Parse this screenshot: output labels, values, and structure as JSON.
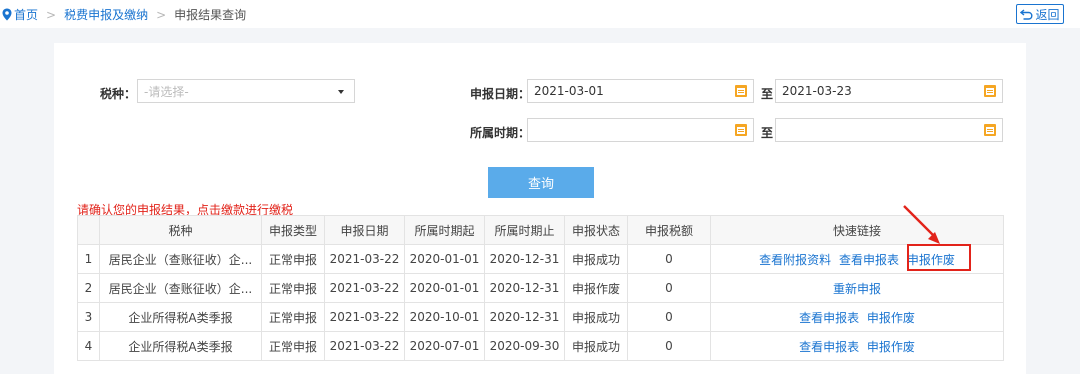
{
  "breadcrumb": {
    "home": "首页",
    "section": "税费申报及缴纳",
    "current": "申报结果查询",
    "separator": ">"
  },
  "back_label": "返回",
  "form": {
    "tax_type_label": "税种：",
    "tax_type_placeholder": "-请选择-",
    "declare_date_label": "申报日期：",
    "declare_date_from": "2021-03-01",
    "declare_date_to": "2021-03-23",
    "period_label": "所属时期：",
    "period_from": "",
    "period_to": "",
    "to_label": "至",
    "query_label": "查询"
  },
  "notice": "请确认您的申报结果，点击缴款进行缴税",
  "table": {
    "headers": [
      "",
      "税种",
      "申报类型",
      "申报日期",
      "所属时期起",
      "所属时期止",
      "申报状态",
      "申报税额",
      "快速链接"
    ],
    "rows": [
      {
        "no": "1",
        "tax": "居民企业（查账征收）企...",
        "type": "正常申报",
        "date": "2021-03-22",
        "from": "2020-01-01",
        "to": "2020-12-31",
        "status": "申报成功",
        "amount": "0",
        "links": [
          "查看附报资料",
          "查看申报表",
          "申报作废"
        ]
      },
      {
        "no": "2",
        "tax": "居民企业（查账征收）企...",
        "type": "正常申报",
        "date": "2021-03-22",
        "from": "2020-01-01",
        "to": "2020-12-31",
        "status": "申报作废",
        "amount": "0",
        "links": [
          "重新申报"
        ]
      },
      {
        "no": "3",
        "tax": "企业所得税A类季报",
        "type": "正常申报",
        "date": "2021-03-22",
        "from": "2020-10-01",
        "to": "2020-12-31",
        "status": "申报成功",
        "amount": "0",
        "links": [
          "查看申报表",
          "申报作废"
        ]
      },
      {
        "no": "4",
        "tax": "企业所得税A类季报",
        "type": "正常申报",
        "date": "2021-03-22",
        "from": "2020-07-01",
        "to": "2020-09-30",
        "status": "申报成功",
        "amount": "0",
        "links": [
          "查看申报表",
          "申报作废"
        ]
      }
    ]
  },
  "colors": {
    "link": "#1a74d0",
    "query_button": "#5aabea",
    "notice": "#e2231a",
    "highlight": "#e2231a",
    "calendar_icon": "#f5a623"
  },
  "icons": {
    "breadcrumb": "location-pin-icon",
    "back": "return-arrow-icon",
    "calendar": "calendar-icon",
    "select": "caret-down-icon",
    "annotation": "red-arrow-icon"
  }
}
